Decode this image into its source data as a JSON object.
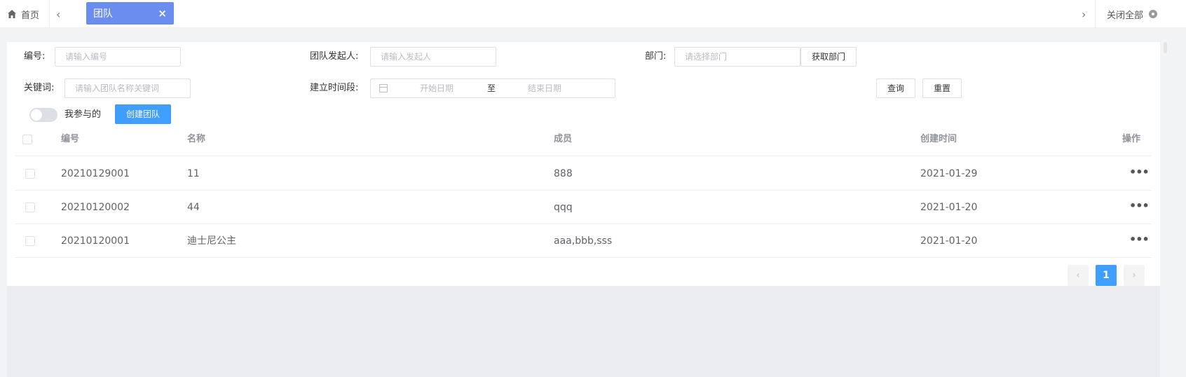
{
  "tabs": {
    "home_label": "首页",
    "prev_arrow": "‹",
    "next_arrow": "›",
    "active_label": "团队",
    "active_close": "×",
    "close_all_label": "关闭全部"
  },
  "filters": {
    "code_label": "编号:",
    "code_placeholder": "请输入编号",
    "initiator_label": "团队发起人:",
    "initiator_placeholder": "请输入发起人",
    "dept_label": "部门:",
    "dept_placeholder": "请选择部门",
    "get_dept_button": "获取部门",
    "keyword_label": "关键词:",
    "keyword_placeholder": "请输入团队名称关键词",
    "period_label": "建立时间段:",
    "start_placeholder": "开始日期",
    "range_separator": "至",
    "end_placeholder": "结束日期",
    "query_button": "查询",
    "reset_button": "重置",
    "mine_switch_label": "我参与的",
    "mine_switch_on": false,
    "create_button": "创建团队"
  },
  "table": {
    "headers": {
      "code": "编号",
      "name": "名称",
      "members": "成员",
      "created": "创建时间",
      "actions": "操作"
    },
    "rows": [
      {
        "code": "20210129001",
        "name": "11",
        "members": "888",
        "created": "2021-01-29",
        "actions": "•••"
      },
      {
        "code": "20210120002",
        "name": "44",
        "members": "qqq",
        "created": "2021-01-20",
        "actions": "•••"
      },
      {
        "code": "20210120001",
        "name": "迪士尼公主",
        "members": "aaa,bbb,sss",
        "created": "2021-01-20",
        "actions": "•••"
      }
    ]
  },
  "pagination": {
    "prev": "‹",
    "current_page": "1",
    "next": "›"
  },
  "colors": {
    "active_tab": "#6c8df0",
    "primary": "#409eff"
  }
}
